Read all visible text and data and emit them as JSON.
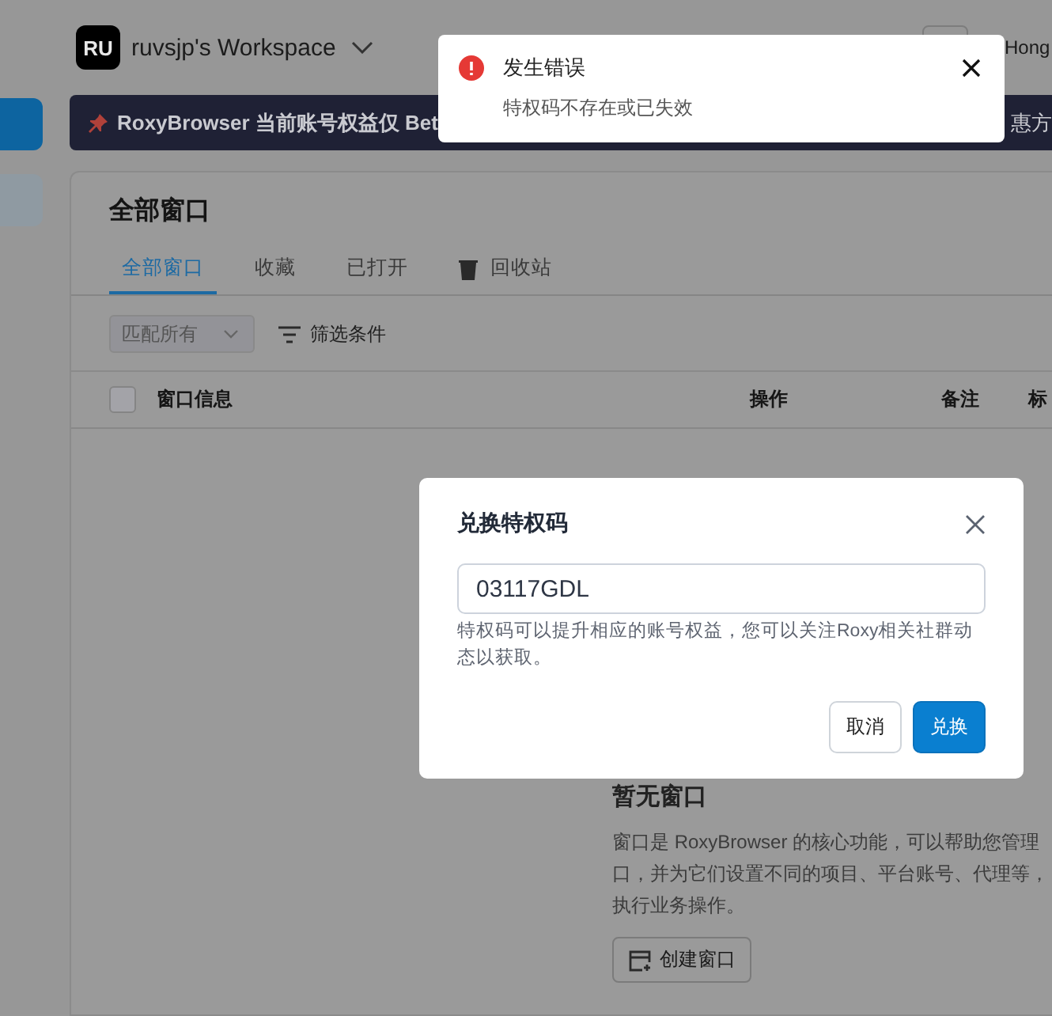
{
  "workspace": {
    "avatar": "RU",
    "name": "ruvsjp's Workspace",
    "region": "Hong"
  },
  "sidebar_items": [
    {
      "selected": true
    },
    {
      "selected": false
    }
  ],
  "banner": {
    "text": "RoxyBrowser 当前账号权益仅 Bet",
    "text_end": "惠方"
  },
  "toast": {
    "kind": "error",
    "title": "发生错误",
    "message": "特权码不存在或已失效"
  },
  "page": {
    "title": "全部窗口",
    "tabs": [
      {
        "label": "全部窗口",
        "selected": true,
        "kind": "plain"
      },
      {
        "label": "收藏",
        "selected": false,
        "kind": "plain"
      },
      {
        "label": "已打开",
        "selected": false,
        "kind": "plain"
      },
      {
        "label": "回收站",
        "selected": false,
        "kind": "with_icon"
      }
    ]
  },
  "toolbar": {
    "match_select": "匹配所有",
    "filter_button": "筛选条件"
  },
  "table": {
    "checked": false,
    "columns": [
      "窗口信息",
      "操作",
      "备注",
      "标"
    ]
  },
  "empty": {
    "title": "暂无窗口",
    "lines": [
      "窗口是 RoxyBrowser 的核心功能，可以帮助您管理",
      "口，并为它们设置不同的项目、平台账号、代理等，",
      "执行业务操作。"
    ],
    "button": "创建窗口"
  },
  "dialog": {
    "title": "兑换特权码",
    "value": "03117GDL",
    "help": "特权码可以提升相应的账号权益，您可以关注Roxy相关社群动态以获取。",
    "buttons": [
      {
        "label": "取消",
        "kind": "default"
      },
      {
        "label": "兑换",
        "kind": "primary"
      }
    ]
  }
}
